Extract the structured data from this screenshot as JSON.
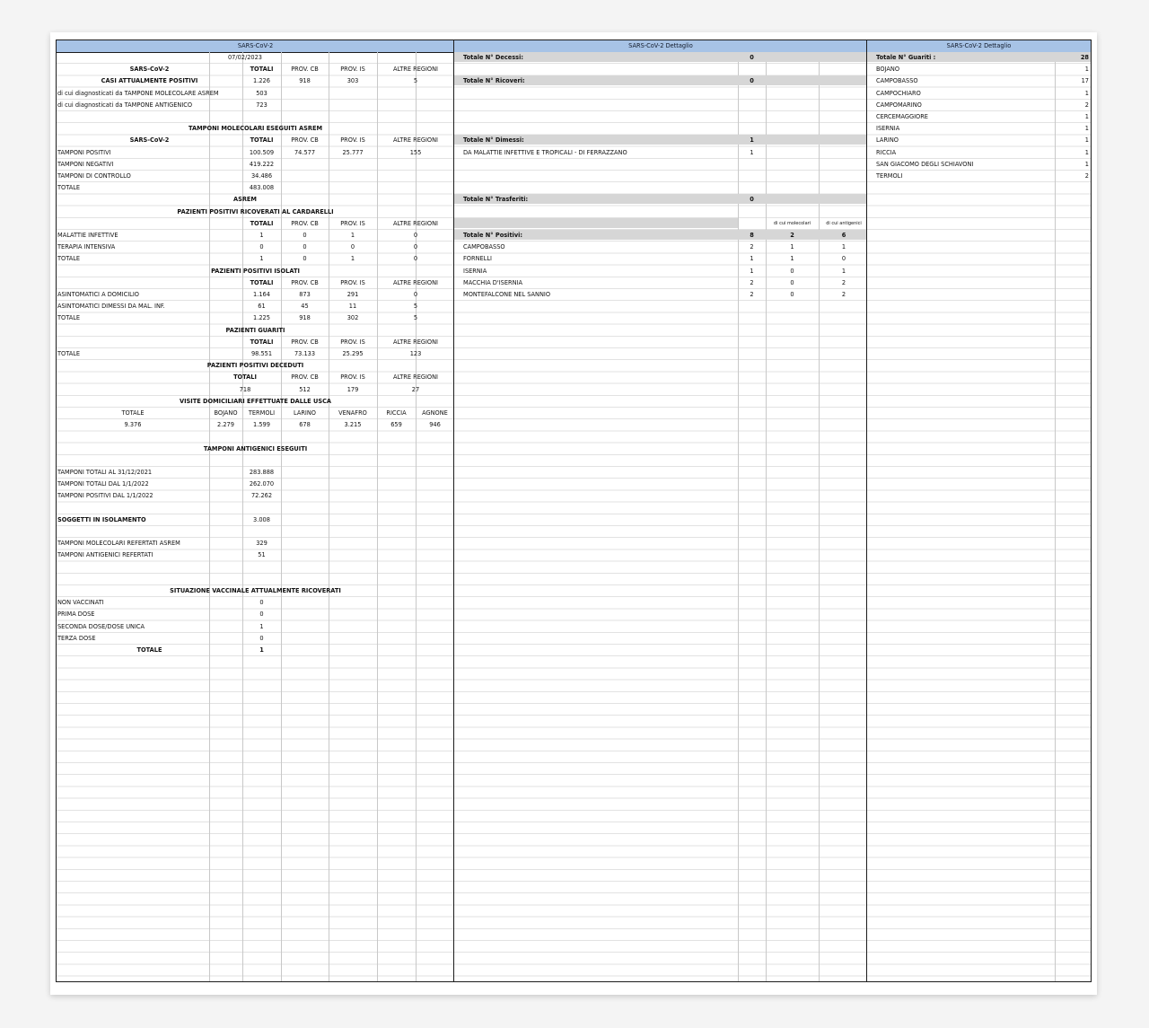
{
  "left": {
    "header": "SARS-CoV-2",
    "date": "07/02/2023",
    "col_totali": "TOTALI",
    "col_cb": "PROV. CB",
    "col_is": "PROV. IS",
    "col_altre": "ALTRE REGIONI",
    "sars": "SARS-CoV-2",
    "casi": {
      "title": "CASI ATTUALMENTE POSITIVI",
      "totali": "1.226",
      "cb": "918",
      "is": "303",
      "altre": "5",
      "rows": [
        {
          "label": "di cui diagnosticati da TAMPONE MOLECOLARE ASREM",
          "value": "503"
        },
        {
          "label": "di cui diagnosticati da TAMPONE ANTIGENICO",
          "value": "723"
        }
      ]
    },
    "tamponi_mol": {
      "title": "TAMPONI MOLECOLARI ESEGUITI ASREM",
      "rows": [
        {
          "label": "TAMPONI POSITIVI",
          "totali": "100.509",
          "cb": "74.577",
          "is": "25.777",
          "altre": "155"
        },
        {
          "label": "TAMPONI NEGATIVI",
          "totali": "419.222",
          "cb": "",
          "is": "",
          "altre": ""
        },
        {
          "label": "TAMPONI DI CONTROLLO",
          "totali": "34.486",
          "cb": "",
          "is": "",
          "altre": ""
        },
        {
          "label": "TOTALE",
          "totali": "483.008",
          "cb": "",
          "is": "",
          "altre": ""
        }
      ],
      "footer": "ASREM"
    },
    "ricoverati": {
      "title": "PAZIENTI POSITIVI RICOVERATI AL CARDARELLI",
      "rows": [
        {
          "label": "MALATTIE INFETTIVE",
          "totali": "1",
          "cb": "0",
          "is": "1",
          "altre": "0"
        },
        {
          "label": "TERAPIA INTENSIVA",
          "totali": "0",
          "cb": "0",
          "is": "0",
          "altre": "0"
        },
        {
          "label": "TOTALE",
          "totali": "1",
          "cb": "0",
          "is": "1",
          "altre": "0"
        }
      ]
    },
    "isolati": {
      "title": "PAZIENTI POSITIVI ISOLATI",
      "rows": [
        {
          "label": "ASINTOMATICI A DOMICILIO",
          "totali": "1.164",
          "cb": "873",
          "is": "291",
          "altre": "0"
        },
        {
          "label": "ASINTOMATICI DIMESSI DA MAL. INF.",
          "totali": "61",
          "cb": "45",
          "is": "11",
          "altre": "5"
        },
        {
          "label": "TOTALE",
          "totali": "1.225",
          "cb": "918",
          "is": "302",
          "altre": "5"
        }
      ]
    },
    "guariti": {
      "title": "PAZIENTI GUARITI",
      "label": "TOTALE",
      "totali": "98.551",
      "cb": "73.133",
      "is": "25.295",
      "altre": "123"
    },
    "deceduti": {
      "title": "PAZIENTI POSITIVI DECEDUTI",
      "totali": "718",
      "cb": "512",
      "is": "179",
      "altre": "27"
    },
    "usca": {
      "title": "VISITE DOMICILIARI EFFETTUATE DALLE USCA",
      "headers": [
        "TOTALE",
        "BOJANO",
        "TERMOLI",
        "LARINO",
        "VENAFRO",
        "RICCIA",
        "AGNONE"
      ],
      "values": [
        "9.376",
        "2.279",
        "1.599",
        "678",
        "3.215",
        "659",
        "946"
      ]
    },
    "antigenici": {
      "title": "TAMPONI ANTIGENICI ESEGUITI",
      "rows": [
        {
          "label": "TAMPONI TOTALI AL 31/12/2021",
          "value": "283.888"
        },
        {
          "label": "TAMPONI TOTALI DAL 1/1/2022",
          "value": "262.070"
        },
        {
          "label": "TAMPONI POSITIVI DAL 1/1/2022",
          "value": "72.262"
        }
      ]
    },
    "isolamento": {
      "label": "SOGGETTI IN ISOLAMENTO",
      "value": "3.008"
    },
    "refertati": [
      {
        "label": "TAMPONI MOLECOLARI REFERTATI ASREM",
        "value": "329"
      },
      {
        "label": "TAMPONI ANTIGENICI REFERTATI",
        "value": "51"
      }
    ],
    "vaccinale": {
      "title": "SITUAZIONE VACCINALE ATTUALMENTE RICOVERATI",
      "rows": [
        {
          "label": "NON VACCINATI",
          "value": "0"
        },
        {
          "label": "PRIMA DOSE",
          "value": "0"
        },
        {
          "label": "SECONDA DOSE/DOSE UNICA",
          "value": "1"
        },
        {
          "label": "TERZA DOSE",
          "value": "0"
        }
      ],
      "total_label": "TOTALE",
      "total_value": "1"
    }
  },
  "middle": {
    "header": "SARS-CoV-2 Dettaglio",
    "decessi": {
      "label": "Totale N° Decessi:",
      "value": "0"
    },
    "ricoveri": {
      "label": "Totale N° Ricoveri:",
      "value": "0"
    },
    "dimessi": {
      "label": "Totale N° Dimessi:",
      "value": "1",
      "rows": [
        {
          "label": "DA MALATTIE INFETTIVE E TROPICALI - DI FERRAZZANO",
          "value": "1"
        }
      ]
    },
    "trasferiti": {
      "label": "Totale N° Trasferiti:",
      "value": "0"
    },
    "positivi": {
      "label": "Totale N° Positivi:",
      "value": "8",
      "mol": "2",
      "ant": "6",
      "col_mol": "di cui molecolari",
      "col_ant": "di cui antigenici",
      "rows": [
        {
          "label": "CAMPOBASSO",
          "tot": "2",
          "mol": "1",
          "ant": "1"
        },
        {
          "label": "FORNELLI",
          "tot": "1",
          "mol": "1",
          "ant": "0"
        },
        {
          "label": "ISERNIA",
          "tot": "1",
          "mol": "0",
          "ant": "1"
        },
        {
          "label": "MACCHIA D'ISERNIA",
          "tot": "2",
          "mol": "0",
          "ant": "2"
        },
        {
          "label": "MONTEFALCONE NEL SANNIO",
          "tot": "2",
          "mol": "0",
          "ant": "2"
        }
      ]
    }
  },
  "right": {
    "header": "SARS-CoV-2 Dettaglio",
    "guariti_label": "Totale N° Guariti :",
    "guariti_value": "28",
    "rows": [
      {
        "label": "BOJANO",
        "value": "1"
      },
      {
        "label": "CAMPOBASSO",
        "value": "17"
      },
      {
        "label": "CAMPOCHIARO",
        "value": "1"
      },
      {
        "label": "CAMPOMARINO",
        "value": "2"
      },
      {
        "label": "CERCEMAGGIORE",
        "value": "1"
      },
      {
        "label": "ISERNIA",
        "value": "1"
      },
      {
        "label": "LARINO",
        "value": "1"
      },
      {
        "label": "RICCIA",
        "value": "1"
      },
      {
        "label": "SAN GIACOMO DEGLI SCHIAVONI",
        "value": "1"
      },
      {
        "label": "TERMOLI",
        "value": "2"
      }
    ]
  }
}
